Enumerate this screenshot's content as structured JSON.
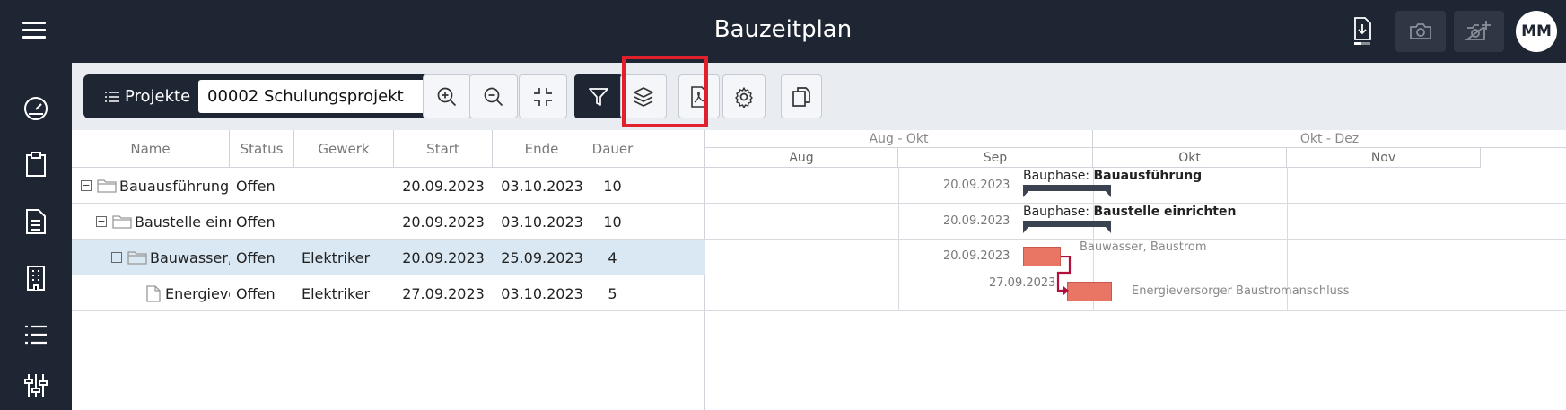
{
  "app": {
    "title": "Bauzeitplan",
    "user_initials": "MM"
  },
  "topbar_icons": [
    "download-icon",
    "camera-icon",
    "add-camera-icon"
  ],
  "sidebar": {
    "items": [
      "dashboard-icon",
      "clipboard-icon",
      "document-icon",
      "building-icon",
      "list-icon",
      "sliders-icon"
    ]
  },
  "toolbar": {
    "projects_label": "Projekte",
    "project_selected": "00002 Schulungsprojekt",
    "buttons": [
      "zoom-in-icon",
      "zoom-out-icon",
      "collapse-icon",
      "filter-icon",
      "layers-icon",
      "pdf-icon",
      "settings-icon",
      "copy-icon"
    ],
    "active_button": "filter-icon",
    "accent_color": "#e0202a"
  },
  "grid": {
    "columns": [
      "Name",
      "Status",
      "Gewerk",
      "Start",
      "Ende",
      "Dauer"
    ],
    "rows": [
      {
        "name": "Bauausführung",
        "status": "Offen",
        "gewerk": "",
        "start": "20.09.2023",
        "ende": "03.10.2023",
        "dauer": "10",
        "type": "folder",
        "level": 0
      },
      {
        "name": "Baustelle einrich",
        "status": "Offen",
        "gewerk": "",
        "start": "20.09.2023",
        "ende": "03.10.2023",
        "dauer": "10",
        "type": "folder",
        "level": 1
      },
      {
        "name": "Bauwasser, Ba",
        "status": "Offen",
        "gewerk": "Elektriker",
        "start": "20.09.2023",
        "ende": "25.09.2023",
        "dauer": "4",
        "type": "folder",
        "level": 2,
        "selected": true
      },
      {
        "name": "Energievers",
        "status": "Offen",
        "gewerk": "Elektriker",
        "start": "27.09.2023",
        "ende": "03.10.2023",
        "dauer": "5",
        "type": "file",
        "level": 3
      }
    ]
  },
  "gantt": {
    "periods": [
      "Aug - Okt",
      "Okt - Dez"
    ],
    "months": [
      "Aug",
      "Sep",
      "Okt",
      "Nov"
    ],
    "rows": [
      {
        "date": "20.09.2023",
        "label_prefix": "Bauphase: ",
        "label_bold": "Bauausführung"
      },
      {
        "date": "20.09.2023",
        "label_prefix": "Bauphase: ",
        "label_bold": "Baustelle einrichten"
      },
      {
        "date": "20.09.2023",
        "label": "Bauwasser, Baustrom"
      },
      {
        "date": "27.09.2023",
        "label": "Energieversorger Baustromanschluss"
      }
    ],
    "task_color": "#e97565",
    "link_color": "#b0103a"
  }
}
